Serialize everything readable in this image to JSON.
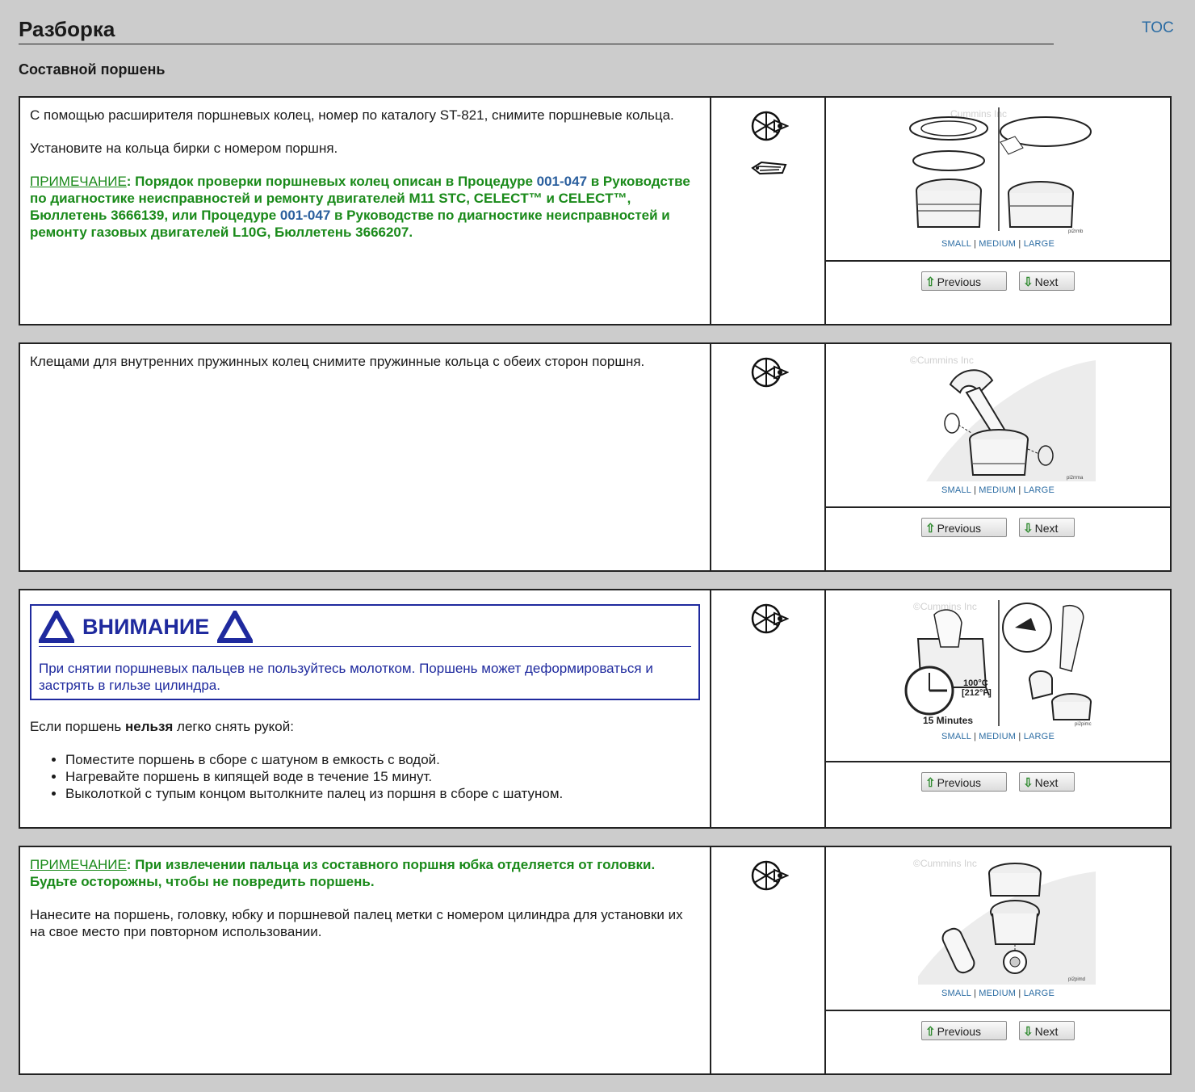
{
  "header": {
    "title": "Разборка",
    "toc": "TOC"
  },
  "subtitle": "Составной поршень",
  "figure_labels": {
    "small": "SMALL",
    "medium": "MEDIUM",
    "large": "LARGE",
    "sep": "|",
    "previous": "Previous",
    "next": "Next"
  },
  "steps": [
    {
      "text1": "С помощью расширителя поршневых колец, номер по каталогу ST-821, снимите поршневые кольца.",
      "text2": "Установите на кольца бирки с номером поршня.",
      "note_label": "ПРИМЕЧАНИЕ",
      "note_a": ": Порядок проверки поршневых колец описан в Процедуре ",
      "note_link1": "001-047",
      "note_b": " в Руководстве по диагностике неисправностей и ремонту двигателей M11 STC, CELECT™ и CELECT™, Бюллетень 3666139, или Процедуре ",
      "note_link2": "001-047",
      "note_c": " в Руководстве по диагностике неисправностей и ремонту газовых двигателей L10G, Бюллетень 3666207.",
      "icons": [
        "wrench-disassemble-icon",
        "tag-icon"
      ],
      "figure_caption": "Cummins Inc",
      "figure_code": "pi2rmb"
    },
    {
      "text1": "Клещами для внутренних пружинных колец снимите пружинные кольца с обеих сторон поршня.",
      "icons": [
        "wrench-disassemble-icon"
      ],
      "figure_caption": "©Cummins Inc",
      "figure_code": "pi2rrma"
    },
    {
      "warning_title": "ВНИМАНИЕ",
      "warning_text": "При снятии поршневых пальцев не пользуйтесь молотком. Поршень может деформироваться и застрять в гильзе цилиндра.",
      "text_pre": "Если поршень ",
      "text_bold": "нельзя",
      "text_post": " легко снять рукой:",
      "bullets": [
        "Поместите поршень в сборе с шатуном в емкость с водой.",
        "Нагревайте поршень в кипящей воде в течение 15 минут.",
        "Выколоткой с тупым концом вытолкните палец из поршня в сборе с шатуном."
      ],
      "icons": [
        "wrench-disassemble-icon"
      ],
      "figure_caption": "©Cummins Inc",
      "figure_temp1": "100°C",
      "figure_temp2": "[212°F]",
      "figure_time": "15 Minutes",
      "figure_code": "pi2pimc"
    },
    {
      "note_label": "ПРИМЕЧАНИЕ",
      "note_text": ": При извлечении пальца из составного поршня юбка отделяется от головки. Будьте осторожны, чтобы не повредить поршень.",
      "text1": "Нанесите на поршень, головку, юбку и поршневой палец метки с номером цилиндра для установки их на свое место при повторном использовании.",
      "icons": [
        "wrench-disassemble-icon"
      ],
      "figure_caption": "©Cummins Inc",
      "figure_code": "pi2pimd"
    }
  ]
}
